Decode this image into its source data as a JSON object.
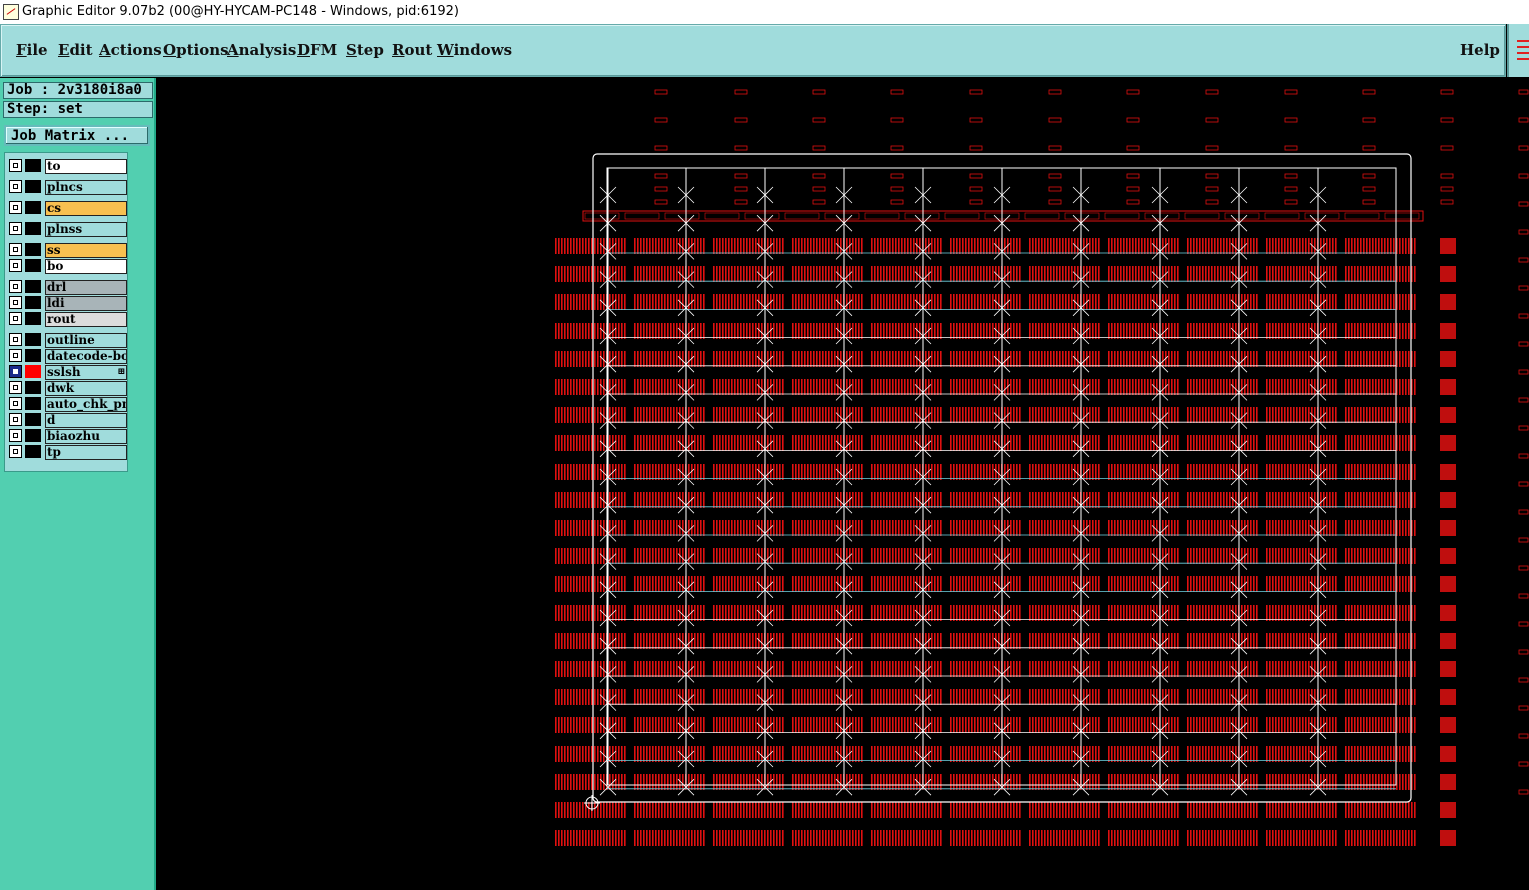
{
  "window": {
    "title": "Graphic Editor 9.07b2 (00@HY-HYCAM-PC148 - Windows, pid:6192)"
  },
  "menu": {
    "items": [
      "File",
      "Edit",
      "Actions",
      "Options",
      "Analysis",
      "DFM",
      "Step",
      "Rout",
      "Windows"
    ],
    "help": "Help"
  },
  "job": {
    "label": "Job : 2v3180i8a0",
    "step": "Step: set"
  },
  "matrix_button": "Job Matrix ...",
  "layers": [
    {
      "name": "to",
      "fill": "#ffffff",
      "checked": false
    },
    {
      "name": "plncs",
      "fill": "#a0dcdc",
      "checked": false
    },
    {
      "name": "cs",
      "fill": "#f8c050",
      "checked": false
    },
    {
      "name": "plnss",
      "fill": "#a0dcdc",
      "checked": false
    },
    {
      "name": "ss",
      "fill": "#f8c050",
      "checked": false
    },
    {
      "name": "bo",
      "fill": "#ffffff",
      "checked": false
    },
    {
      "name": "drl",
      "fill": "#a8b4b8",
      "checked": false
    },
    {
      "name": "ldi",
      "fill": "#a8b4b8",
      "checked": false
    },
    {
      "name": "rout",
      "fill": "#dcdcdc",
      "checked": false
    },
    {
      "name": "outline",
      "fill": "#a0dcdc",
      "checked": false
    },
    {
      "name": "datecode-bo",
      "fill": "#a0dcdc",
      "checked": false
    },
    {
      "name": "sslsh",
      "fill": "#a0dcdc",
      "checked": true,
      "color": "#ff0000"
    },
    {
      "name": "dwk",
      "fill": "#a0dcdc",
      "checked": false
    },
    {
      "name": "auto_chk_pn",
      "fill": "#a0dcdc",
      "checked": false
    },
    {
      "name": "d",
      "fill": "#a0dcdc",
      "checked": false
    },
    {
      "name": "biaozhu",
      "fill": "#a0dcdc",
      "checked": false
    },
    {
      "name": "tp",
      "fill": "#a0dcdc",
      "checked": false
    }
  ],
  "colors": {
    "menubar": "#a0dcdc",
    "panel": "#52cfb0",
    "artwork": "#e01010",
    "outline": "#ffffff",
    "grid": "#6fd6e6"
  }
}
